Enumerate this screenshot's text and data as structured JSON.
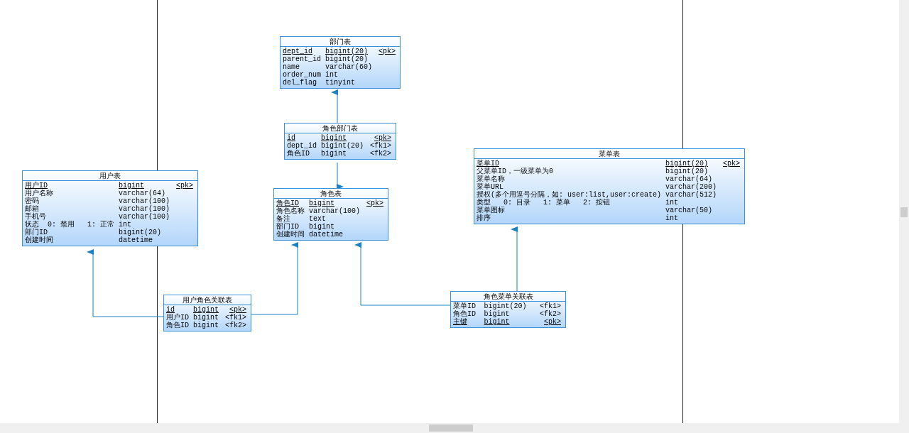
{
  "tables": [
    {
      "title": "部门表",
      "columns": [
        {
          "name": "dept_id",
          "type": "bigint(20)",
          "key": "<pk>",
          "primary": true
        },
        {
          "name": "parent_id",
          "type": "bigint(20)",
          "primary": false
        },
        {
          "name": "name",
          "type": "varchar(60)",
          "primary": false
        },
        {
          "name": "order_num",
          "type": "int",
          "primary": false
        },
        {
          "name": "del_flag",
          "type": "tinyint",
          "primary": false
        }
      ]
    },
    {
      "title": "角色部门表",
      "columns": [
        {
          "name": "id",
          "type": "bigint",
          "key": "<pk>",
          "primary": true
        },
        {
          "name": "dept_id",
          "type": "bigint(20)",
          "key": "<fk1>",
          "primary": false
        },
        {
          "name": "角色ID",
          "type": "bigint",
          "key": "<fk2>",
          "primary": false
        }
      ]
    },
    {
      "title": "用户表",
      "columns": [
        {
          "name": "用户ID",
          "type": "bigint",
          "key": "<pk>",
          "primary": true
        },
        {
          "name": "用户名称",
          "type": "varchar(64)",
          "primary": false
        },
        {
          "name": "密码",
          "type": "varchar(100)",
          "primary": false
        },
        {
          "name": "邮箱",
          "type": "varchar(100)",
          "primary": false
        },
        {
          "name": "手机号",
          "type": "varchar(100)",
          "primary": false
        },
        {
          "name": "状态  0: 禁用   1: 正常",
          "type": "int",
          "primary": false
        },
        {
          "name": "部门ID",
          "type": "bigint(20)",
          "primary": false
        },
        {
          "name": "创建时间",
          "type": "datetime",
          "primary": false
        }
      ]
    },
    {
      "title": "角色表",
      "columns": [
        {
          "name": "角色ID",
          "type": "bigint",
          "key": "<pk>",
          "primary": true
        },
        {
          "name": "角色名称",
          "type": "varchar(100)",
          "primary": false
        },
        {
          "name": "备注",
          "type": "text",
          "primary": false
        },
        {
          "name": "部门ID",
          "type": "bigint",
          "primary": false
        },
        {
          "name": "创建时间",
          "type": "datetime",
          "primary": false
        }
      ]
    },
    {
      "title": "菜单表",
      "columns": [
        {
          "name": "菜单ID",
          "type": "bigint(20)",
          "key": "<pk>",
          "primary": true
        },
        {
          "name": "父菜单ID，一级菜单为0",
          "type": "bigint(20)",
          "primary": false
        },
        {
          "name": "菜单名称",
          "type": "varchar(64)",
          "primary": false
        },
        {
          "name": "菜单URL",
          "type": "varchar(200)",
          "primary": false
        },
        {
          "name": "授权(多个用逗号分隔，如: user:list,user:create)",
          "type": "varchar(512)",
          "primary": false
        },
        {
          "name": "类型   0: 目录   1: 菜单   2: 按钮",
          "type": "int",
          "primary": false
        },
        {
          "name": "菜单图标",
          "type": "varchar(50)",
          "primary": false
        },
        {
          "name": "排序",
          "type": "int",
          "primary": false
        }
      ]
    },
    {
      "title": "用户角色关联表",
      "columns": [
        {
          "name": "id",
          "type": "bigint",
          "key": "<pk>",
          "primary": true
        },
        {
          "name": "用户ID",
          "type": "bigint",
          "key": "<fk1>",
          "primary": false
        },
        {
          "name": "角色ID",
          "type": "bigint",
          "key": "<fk2>",
          "primary": false
        }
      ]
    },
    {
      "title": "角色菜单关联表",
      "columns": [
        {
          "name": "菜单ID",
          "type": "bigint(20)",
          "key": "<fk1>",
          "primary": false
        },
        {
          "name": "角色ID",
          "type": "bigint",
          "key": "<fk2>",
          "primary": false
        },
        {
          "name": "主键",
          "type": "bigint",
          "key": "<pk>",
          "primary": true
        }
      ]
    }
  ]
}
